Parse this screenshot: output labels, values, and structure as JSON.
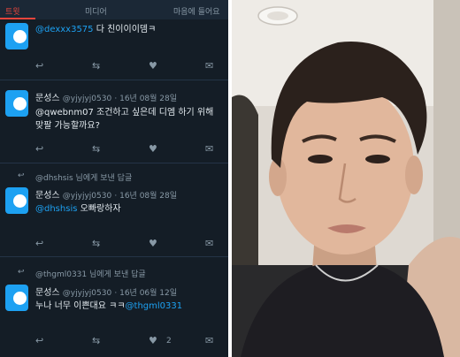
{
  "tabs": [
    "트윗",
    "미디어",
    "마음에 들어요"
  ],
  "tweets": [
    {
      "text_a": "@dexxx3575 ",
      "text_b": "다 친이이이뎀ㅋ"
    },
    {
      "name": "문성스",
      "handle": "@yjyjyj0530",
      "date": "· 16년 08월 28일",
      "line1": "@qwebnm07 조건하고 싶은데 디엠 하기 위해",
      "line2": "맞팔 가능할까요?"
    },
    {
      "reply_context": "@dhshsis 님에게 보낸 답글",
      "name": "문성스",
      "handle": "@yjyjyj0530",
      "date": "· 16년 08월 28일",
      "mention": "@dhshsis",
      "text": " 오빠랑하자"
    },
    {
      "reply_context": "@thgml0331 님에게 보낸 답글",
      "name": "문성스",
      "handle": "@yjyjyj0530",
      "date": "· 16년 06월 12일",
      "text": "누나 너무 이쁜대요 ㅋㅋ",
      "mention": "@thgml0331",
      "like_count": "2"
    }
  ],
  "icons": {
    "reply": "reply-icon",
    "retweet": "retweet-icon",
    "like": "heart-icon",
    "dm": "envelope-icon"
  },
  "colors": {
    "background": "#141d26",
    "link": "#1da1f2",
    "accent": "#e8453c"
  }
}
